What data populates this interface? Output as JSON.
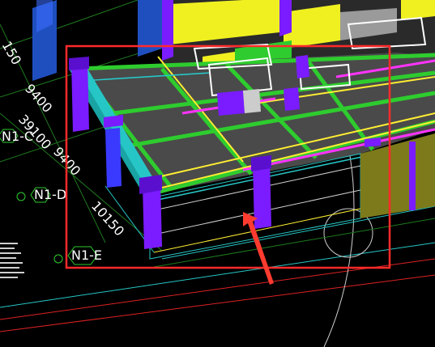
{
  "dimensions": {
    "top": "150",
    "d1": "9400",
    "d2": "39100",
    "d3": "9400",
    "d4": "10150"
  },
  "axes": {
    "c": "N1-C",
    "d": "N1-D",
    "e": "N1-E"
  },
  "colors": {
    "background": "#000000",
    "slab": "#4a4a4a",
    "beam_green": "#2ecc2e",
    "beam_cyan": "#27c6c6",
    "column_purple": "#7a1cff",
    "wall_yellow": "#f0f020",
    "wall_olive": "#7c7a1a",
    "magenta_line": "#ff33ff",
    "selection_box": "#ff2a2a",
    "arrow": "#ff3b2f"
  },
  "icons": {
    "arrow": "red-pointer-arrow",
    "selection": "red-selection-rectangle",
    "axis_marker": "axis-hexagon-marker"
  }
}
